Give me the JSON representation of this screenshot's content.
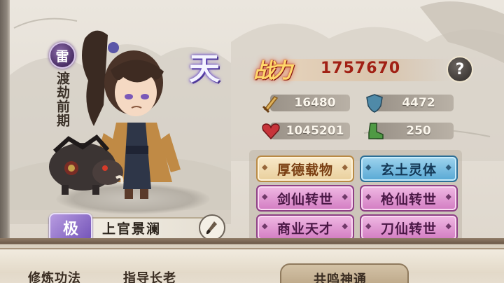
{
  "character": {
    "element": "雷",
    "realm": "渡劫前期",
    "grade": "天",
    "rank_badge": "极",
    "name": "上官景澜"
  },
  "power": {
    "label": "战力",
    "value": "1757670",
    "help": "?"
  },
  "stats": {
    "attack": {
      "icon": "sword-icon",
      "value": "16480"
    },
    "defense": {
      "icon": "shield-icon",
      "value": "4472"
    },
    "hp": {
      "icon": "heart-icon",
      "value": "1045201"
    },
    "speed": {
      "icon": "boot-icon",
      "value": "250"
    }
  },
  "talents": [
    {
      "label": "厚德载物",
      "color": "gold"
    },
    {
      "label": "玄土灵体",
      "color": "blue"
    },
    {
      "label": "剑仙转世",
      "color": "purple"
    },
    {
      "label": "枪仙转世",
      "color": "purple"
    },
    {
      "label": "商业天才",
      "color": "purple"
    },
    {
      "label": "刀仙转世",
      "color": "purple"
    }
  ],
  "bottom": {
    "label_1": "修炼功法",
    "label_2": "指导长老",
    "label_3": "共鸣神通"
  },
  "colors": {
    "gold_talent": "#e9cf9c",
    "blue_talent": "#57a8d4",
    "purple_talent": "#d27cc2",
    "power_value": "#a12014"
  }
}
